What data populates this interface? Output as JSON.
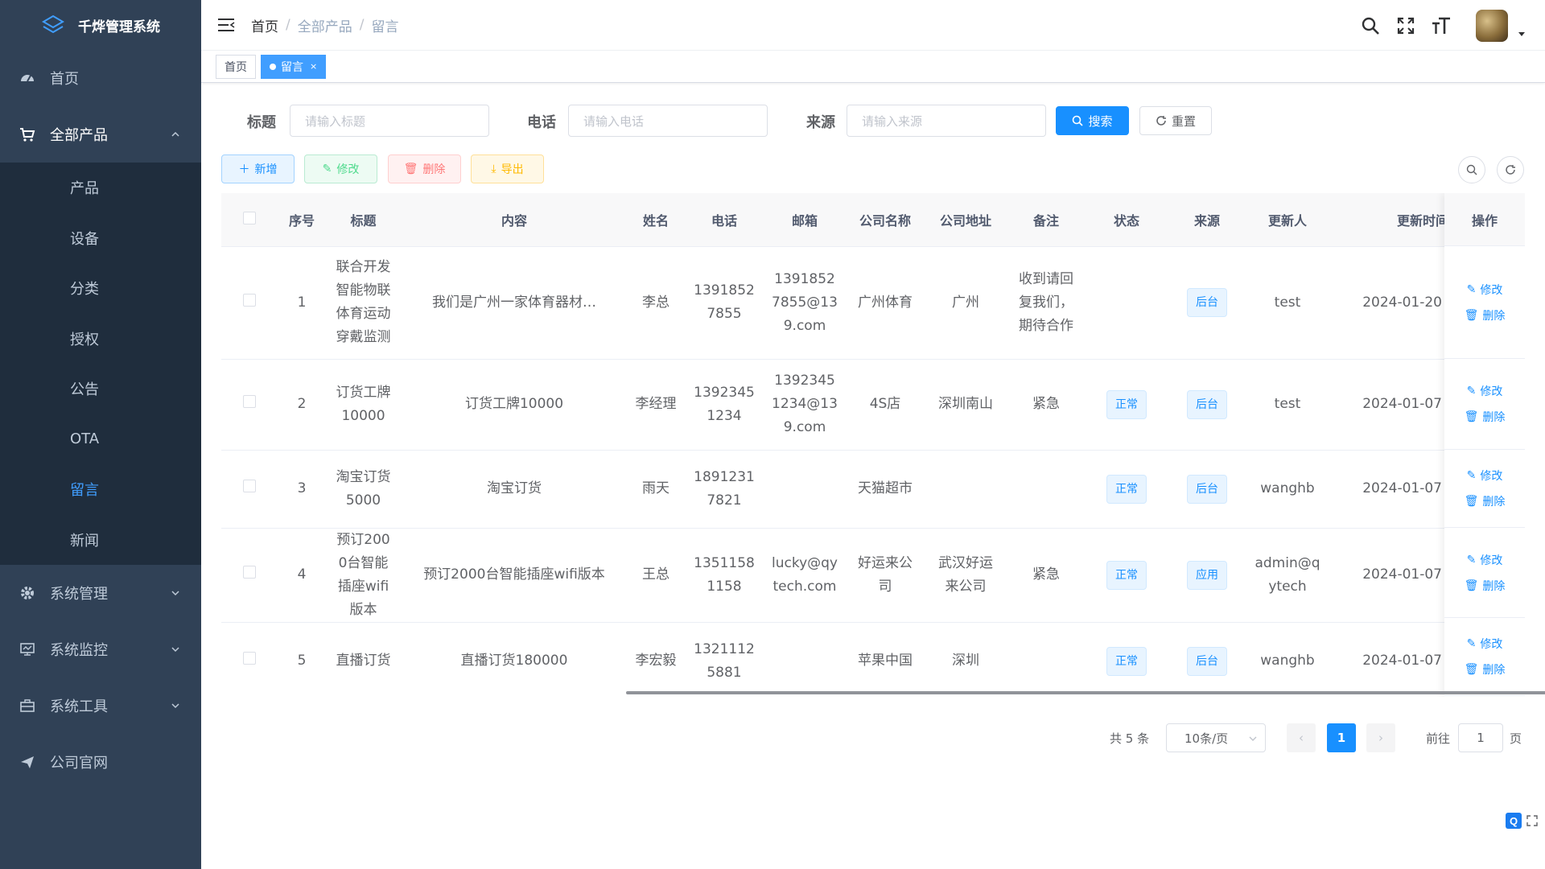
{
  "app": {
    "title": "千烨管理系统"
  },
  "sidebar": {
    "home": "首页",
    "products": "全部产品",
    "sub_items": [
      "产品",
      "设备",
      "分类",
      "授权",
      "公告",
      "OTA",
      "留言",
      "新闻"
    ],
    "system_manage": "系统管理",
    "system_monitor": "系统监控",
    "system_tools": "系统工具",
    "company_site": "公司官网"
  },
  "breadcrumb": [
    "首页",
    "全部产品",
    "留言"
  ],
  "tags": {
    "home": "首页",
    "current": "留言"
  },
  "search": {
    "title_label": "标题",
    "title_placeholder": "请输入标题",
    "phone_label": "电话",
    "phone_placeholder": "请输入电话",
    "source_label": "来源",
    "source_placeholder": "请输入来源",
    "search_button": "搜索",
    "reset_button": "重置"
  },
  "toolbar": {
    "add": "新增",
    "edit": "修改",
    "delete": "删除",
    "export": "导出"
  },
  "table": {
    "columns": [
      "序号",
      "标题",
      "内容",
      "姓名",
      "电话",
      "邮箱",
      "公司名称",
      "公司地址",
      "备注",
      "状态",
      "来源",
      "更新人",
      "更新时间",
      "操作"
    ],
    "rows": [
      {
        "no": "1",
        "title": "联合开发智能物联体育运动穿戴监测",
        "content": "我们是广州一家体育器材…",
        "name": "李总",
        "phone": "13918527855",
        "email": "13918527855@139.com",
        "company": "广州体育",
        "address": "广州",
        "remark": "收到请回复我们，期待合作",
        "status": "",
        "source": "后台",
        "updater": "test",
        "updated": "2024-01-20"
      },
      {
        "no": "2",
        "title": "订货工牌10000",
        "content": "订货工牌10000",
        "name": "李经理",
        "phone": "13923451234",
        "email": "13923451234@139.com",
        "company": "4S店",
        "address": "深圳南山",
        "remark": "紧急",
        "status": "正常",
        "source": "后台",
        "updater": "test",
        "updated": "2024-01-07"
      },
      {
        "no": "3",
        "title": "淘宝订货5000",
        "content": "淘宝订货",
        "name": "雨天",
        "phone": "18912317821",
        "email": "",
        "company": "天猫超市",
        "address": "",
        "remark": "",
        "status": "正常",
        "source": "后台",
        "updater": "wanghb",
        "updated": "2024-01-07"
      },
      {
        "no": "4",
        "title": "预订2000台智能插座wifi版本",
        "content": "预订2000台智能插座wifi版本",
        "name": "王总",
        "phone": "13511581158",
        "email": "lucky@qytech.com",
        "company": "好运来公司",
        "address": "武汉好运来公司",
        "remark": "紧急",
        "status": "正常",
        "source": "应用",
        "updater": "admin@qytech",
        "updated": "2024-01-07"
      },
      {
        "no": "5",
        "title": "直播订货",
        "content": "直播订货180000",
        "name": "李宏毅",
        "phone": "13211125881",
        "email": "",
        "company": "苹果中国",
        "address": "深圳",
        "remark": "",
        "status": "正常",
        "source": "后台",
        "updater": "wanghb",
        "updated": "2024-01-07"
      }
    ],
    "op_edit": "修改",
    "op_delete": "删除"
  },
  "pagination": {
    "total": "共 5 条",
    "page_size": "10条/页",
    "current": "1",
    "goto_label": "前往",
    "goto_value": "1",
    "page_suffix": "页"
  },
  "colors": {
    "sidebar_bg": "#304156",
    "submenu_bg": "#1f2d3d",
    "primary": "#1890ff"
  }
}
